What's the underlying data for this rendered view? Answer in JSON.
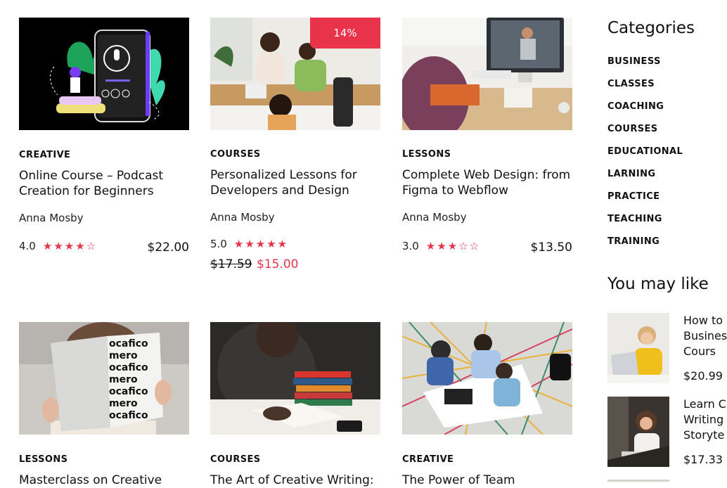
{
  "courses": [
    {
      "category": "CREATIVE",
      "title": "Online Course – Podcast Creation for Beginners",
      "author": "Anna Mosby",
      "rating": "4.0",
      "stars": 4,
      "price": "$22.00",
      "image": "podcast-illustration"
    },
    {
      "category": "COURSES",
      "title": "Personalized Lessons for Developers and Design",
      "author": "Anna Mosby",
      "rating": "5.0",
      "stars": 5,
      "old_price": "$17.59",
      "sale_price": "$15.00",
      "badge": "14%",
      "image": "team-meeting-photo"
    },
    {
      "category": "LESSONS",
      "title": "Complete Web Design: from Figma to Webflow",
      "author": "Anna Mosby",
      "rating": "3.0",
      "stars": 3,
      "price": "$13.50",
      "image": "video-call-photo"
    },
    {
      "category": "LESSONS",
      "title": "Masterclass on Creative",
      "image": "magazine-reader-photo"
    },
    {
      "category": "COURSES",
      "title": "The Art of Creative Writing:",
      "image": "man-reading-book-photo"
    },
    {
      "category": "CREATIVE",
      "title": "The Power of Team",
      "image": "team-laptops-photo"
    }
  ],
  "sidebar": {
    "categories_heading": "Categories",
    "categories": [
      "BUSINESS",
      "CLASSES",
      "COACHING",
      "COURSES",
      "EDUCATIONAL",
      "LARNING",
      "PRACTICE",
      "TEACHING",
      "TRAINING"
    ],
    "you_may_like_heading": "You may like",
    "you_may_like": [
      {
        "title": "How to\nBusines\nCours",
        "price": "$20.99",
        "image": "woman-laptop-photo"
      },
      {
        "title": "Learn C\nWriting\nStoryte",
        "price": "$17.33",
        "image": "girl-writing-photo"
      }
    ]
  },
  "colors": {
    "accent": "#e9334a",
    "text": "#111111"
  },
  "star_glyphs": {
    "filled": "★",
    "empty": "☆"
  }
}
